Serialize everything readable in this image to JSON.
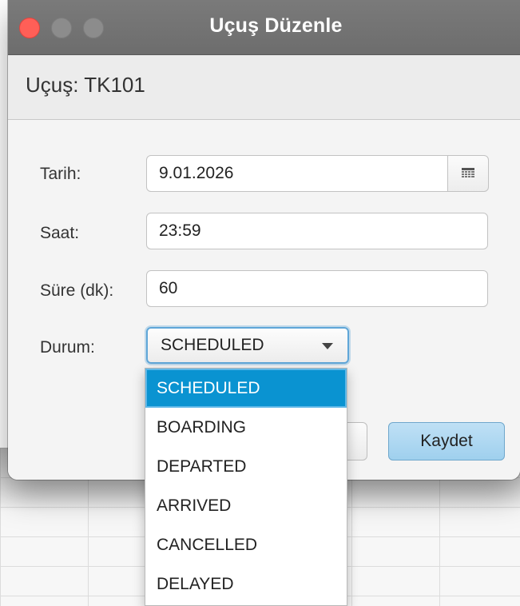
{
  "window": {
    "title": "Uçuş Düzenle"
  },
  "header": {
    "flight_label": "Uçuş: TK101"
  },
  "form": {
    "date_label": "Tarih:",
    "date_value": "9.01.2026",
    "time_label": "Saat:",
    "time_value": "23:59",
    "duration_label": "Süre (dk):",
    "duration_value": "60",
    "status_label": "Durum:",
    "status_value": "SCHEDULED"
  },
  "status_options": [
    "SCHEDULED",
    "BOARDING",
    "DEPARTED",
    "ARRIVED",
    "CANCELLED",
    "DELAYED"
  ],
  "buttons": {
    "save_label": "Kaydet"
  },
  "colors": {
    "selection": "#0a93d1",
    "focus_ring": "#5fa6d8",
    "close_button": "#ff5f57"
  },
  "icons": {
    "calendar": "calendar-icon",
    "dropdown": "chevron-down-icon"
  }
}
